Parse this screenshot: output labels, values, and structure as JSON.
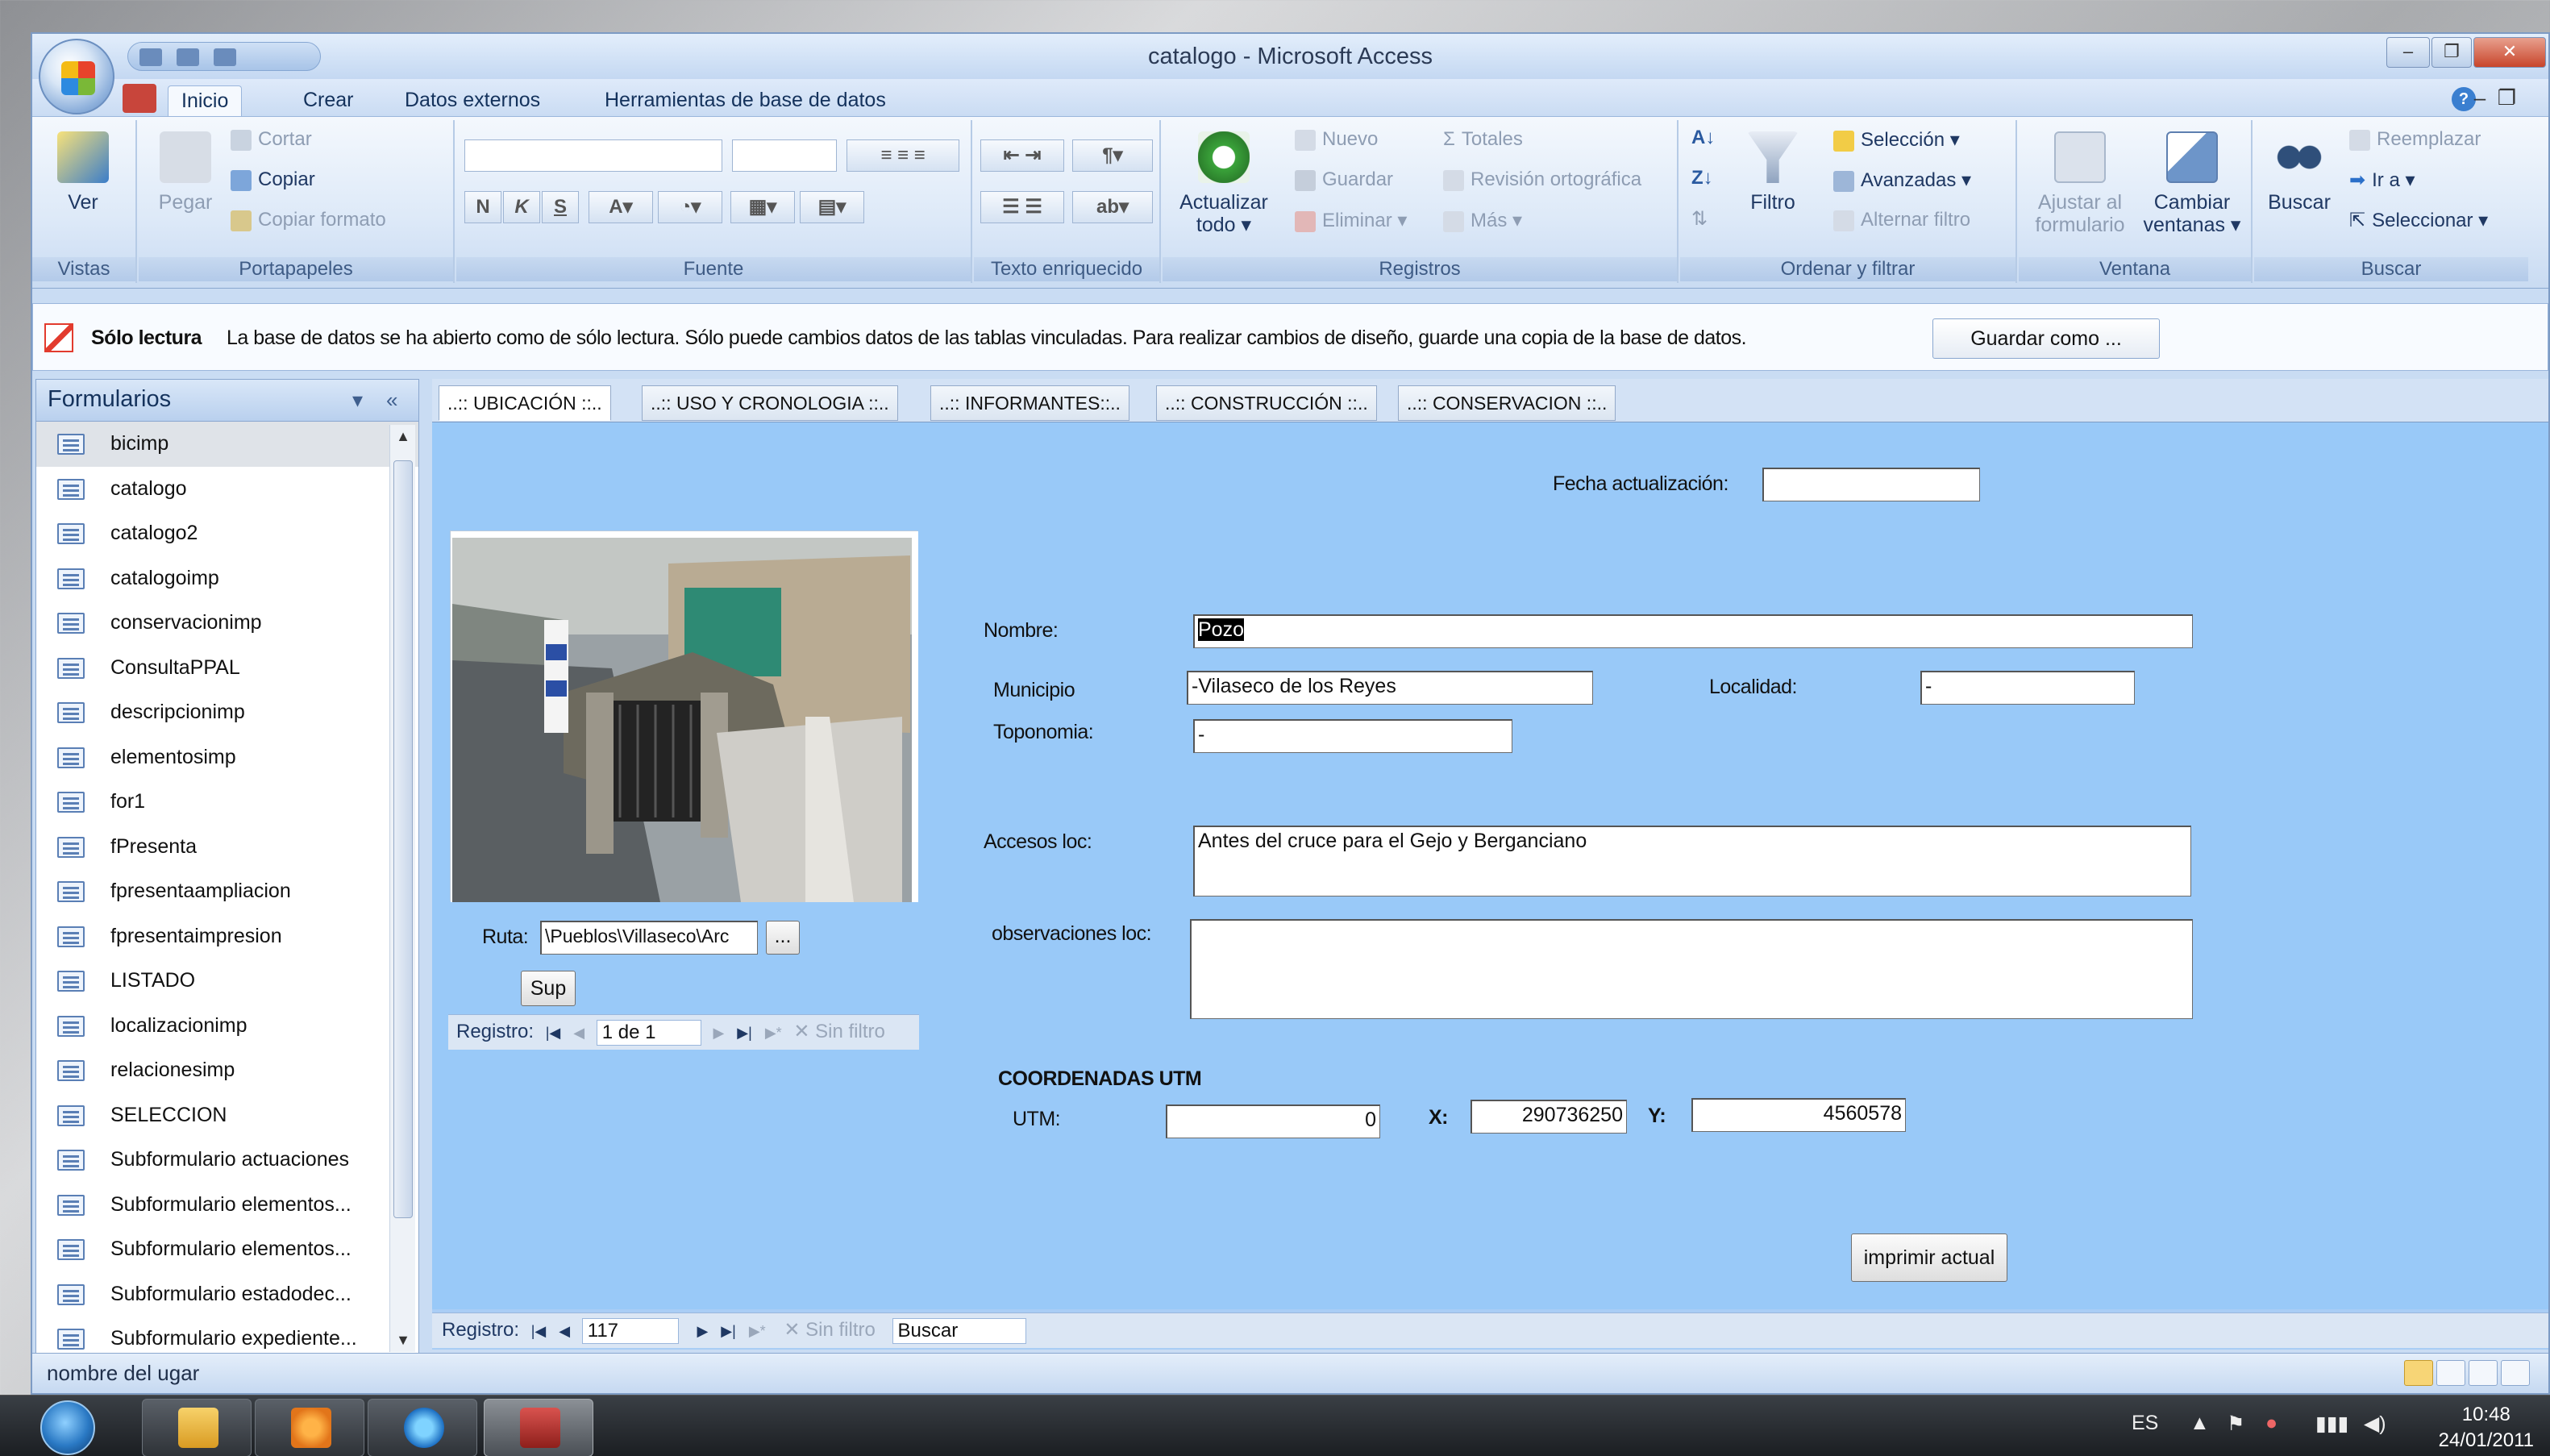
{
  "window": {
    "title": "catalogo - Microsoft Access"
  },
  "menu_tabs": [
    "Inicio",
    "Crear",
    "Datos externos",
    "Herramientas de base de datos"
  ],
  "ribbon": {
    "vistas": {
      "ver": "Ver",
      "group": "Vistas"
    },
    "portapapeles": {
      "pegar": "Pegar",
      "cortar": "Cortar",
      "copiar": "Copiar",
      "copiar_formato": "Copiar formato",
      "group": "Portapapeles"
    },
    "fuente": {
      "bold": "N",
      "italic": "K",
      "underline": "S",
      "group": "Fuente"
    },
    "texto": {
      "group": "Texto enriquecido"
    },
    "registros": {
      "actualizar": "Actualizar",
      "actualizar2": "todo",
      "nuevo": "Nuevo",
      "guardar": "Guardar",
      "eliminar": "Eliminar",
      "totales": "Totales",
      "revision": "Revisión ortográfica",
      "mas": "Más",
      "group": "Registros"
    },
    "ordenar": {
      "filtro": "Filtro",
      "seleccion": "Selección",
      "avanzadas": "Avanzadas",
      "alternar": "Alternar filtro",
      "group": "Ordenar y filtrar"
    },
    "ventana": {
      "ajustar": "Ajustar al",
      "ajustar2": "formulario",
      "cambiar": "Cambiar",
      "cambiar2": "ventanas",
      "group": "Ventana"
    },
    "buscar": {
      "buscar": "Buscar",
      "reemplazar": "Reemplazar",
      "ira": "Ir a",
      "seleccionar": "Seleccionar",
      "group": "Buscar"
    }
  },
  "message_bar": {
    "title": "Sólo lectura",
    "text": "La base de datos se ha abierto como de sólo lectura. Sólo puede cambios datos de las tablas vinculadas. Para realizar cambios de diseño, guarde una copia de la base de datos.",
    "button": "Guardar como ..."
  },
  "nav_pane": {
    "title": "Formularios",
    "items": [
      "bicimp",
      "catalogo",
      "catalogo2",
      "catalogoimp",
      "conservacionimp",
      "ConsultaPPAL",
      "descripcionimp",
      "elementosimp",
      "for1",
      "fPresenta",
      "fpresentaampliacion",
      "fpresentaimpresion",
      "LISTADO",
      "localizacionimp",
      "relacionesimp",
      "SELECCION",
      "Subformulario actuaciones",
      "Subformulario elementos...",
      "Subformulario elementos...",
      "Subformulario estadodec...",
      "Subformulario expediente..."
    ]
  },
  "form_tabs": [
    "..:: UBICACIÓN ::..",
    "..:: USO Y CRONOLOGIA ::..",
    "..:: INFORMANTES::..",
    "..:: CONSTRUCCIÓN ::..",
    "..:: CONSERVACION ::.."
  ],
  "form": {
    "fecha_label": "Fecha actualización:",
    "fecha_value": "",
    "nombre_label": "Nombre:",
    "nombre_value": "Pozo",
    "municipio_label": "Municipio",
    "municipio_value": "-Vilaseco de los Reyes",
    "localidad_label": "Localidad:",
    "localidad_value": "-",
    "toponomia_label": "Toponomia:",
    "toponomia_value": "-",
    "accesos_label": "Accesos loc:",
    "accesos_value": "Antes del cruce para el Gejo y Berganciano",
    "observaciones_label": "observaciones loc:",
    "observaciones_value": "",
    "ruta_label": "Ruta:",
    "ruta_value": "\\Pueblos\\Villaseco\\Arc",
    "ruta_button": "...",
    "sup_button": "Sup",
    "coord_title": "COORDENADAS UTM",
    "utm_label": "UTM:",
    "utm_value": "0",
    "x_label": "X:",
    "x_value": "290736250",
    "y_label": "Y:",
    "y_value": "4560578",
    "imprimir_button": "imprimir actual"
  },
  "subform_record": {
    "label": "Registro:",
    "value": "1 de 1",
    "filter": "Sin filtro"
  },
  "record_bar": {
    "label": "Registro:",
    "value": "117",
    "filter": "Sin filtro",
    "search": "Buscar"
  },
  "status_text": "nombre del ugar",
  "taskbar": {
    "lang": "ES",
    "time": "10:48",
    "date": "24/01/2011"
  }
}
